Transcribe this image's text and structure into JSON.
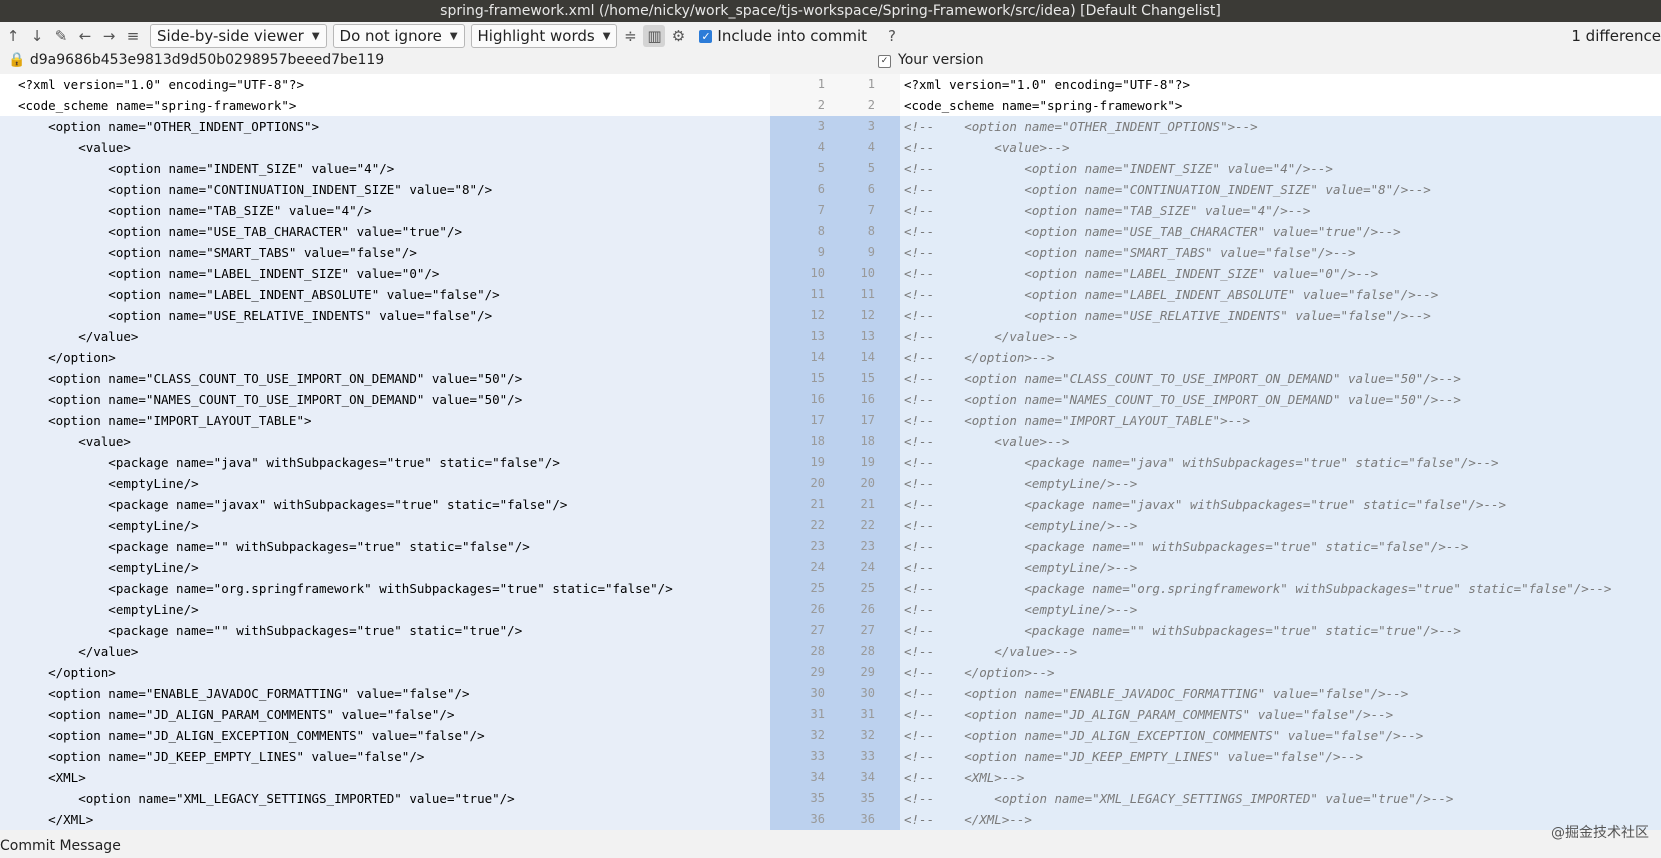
{
  "title": "spring-framework.xml (/home/nicky/work_space/tjs-workspace/Spring-Framework/src/idea) [Default Changelist]",
  "toolbar": {
    "icons": [
      "up-arrow-icon",
      "down-arrow-icon",
      "edit-icon",
      "back-icon",
      "forward-icon",
      "list-icon"
    ],
    "viewer": "Side-by-side viewer",
    "ignore": "Do not ignore",
    "highlight": "Highlight words",
    "include_label": "Include into commit",
    "help": "?",
    "diff_count": "1 difference"
  },
  "left_header": "d9a9686b453e9813d9d50b0298957beeed7be119",
  "right_header": "Your version",
  "commit_label": "Commit Message",
  "watermark": "@掘金技术社区",
  "left_lines": [
    "<?xml version=\"1.0\" encoding=\"UTF-8\"?>",
    "<code_scheme name=\"spring-framework\">",
    "    <option name=\"OTHER_INDENT_OPTIONS\">",
    "        <value>",
    "            <option name=\"INDENT_SIZE\" value=\"4\"/>",
    "            <option name=\"CONTINUATION_INDENT_SIZE\" value=\"8\"/>",
    "            <option name=\"TAB_SIZE\" value=\"4\"/>",
    "            <option name=\"USE_TAB_CHARACTER\" value=\"true\"/>",
    "            <option name=\"SMART_TABS\" value=\"false\"/>",
    "            <option name=\"LABEL_INDENT_SIZE\" value=\"0\"/>",
    "            <option name=\"LABEL_INDENT_ABSOLUTE\" value=\"false\"/>",
    "            <option name=\"USE_RELATIVE_INDENTS\" value=\"false\"/>",
    "        </value>",
    "    </option>",
    "    <option name=\"CLASS_COUNT_TO_USE_IMPORT_ON_DEMAND\" value=\"50\"/>",
    "    <option name=\"NAMES_COUNT_TO_USE_IMPORT_ON_DEMAND\" value=\"50\"/>",
    "    <option name=\"IMPORT_LAYOUT_TABLE\">",
    "        <value>",
    "            <package name=\"java\" withSubpackages=\"true\" static=\"false\"/>",
    "            <emptyLine/>",
    "            <package name=\"javax\" withSubpackages=\"true\" static=\"false\"/>",
    "            <emptyLine/>",
    "            <package name=\"\" withSubpackages=\"true\" static=\"false\"/>",
    "            <emptyLine/>",
    "            <package name=\"org.springframework\" withSubpackages=\"true\" static=\"false\"/>",
    "            <emptyLine/>",
    "            <package name=\"\" withSubpackages=\"true\" static=\"true\"/>",
    "        </value>",
    "    </option>",
    "    <option name=\"ENABLE_JAVADOC_FORMATTING\" value=\"false\"/>",
    "    <option name=\"JD_ALIGN_PARAM_COMMENTS\" value=\"false\"/>",
    "    <option name=\"JD_ALIGN_EXCEPTION_COMMENTS\" value=\"false\"/>",
    "    <option name=\"JD_KEEP_EMPTY_LINES\" value=\"false\"/>",
    "    <XML>",
    "        <option name=\"XML_LEGACY_SETTINGS_IMPORTED\" value=\"true\"/>",
    "    </XML>"
  ],
  "right_lines": [
    "<?xml version=\"1.0\" encoding=\"UTF-8\"?>",
    "<code_scheme name=\"spring-framework\">",
    "<!--    <option name=\"OTHER_INDENT_OPTIONS\">-->",
    "<!--        <value>-->",
    "<!--            <option name=\"INDENT_SIZE\" value=\"4\"/>-->",
    "<!--            <option name=\"CONTINUATION_INDENT_SIZE\" value=\"8\"/>-->",
    "<!--            <option name=\"TAB_SIZE\" value=\"4\"/>-->",
    "<!--            <option name=\"USE_TAB_CHARACTER\" value=\"true\"/>-->",
    "<!--            <option name=\"SMART_TABS\" value=\"false\"/>-->",
    "<!--            <option name=\"LABEL_INDENT_SIZE\" value=\"0\"/>-->",
    "<!--            <option name=\"LABEL_INDENT_ABSOLUTE\" value=\"false\"/>-->",
    "<!--            <option name=\"USE_RELATIVE_INDENTS\" value=\"false\"/>-->",
    "<!--        </value>-->",
    "<!--    </option>-->",
    "<!--    <option name=\"CLASS_COUNT_TO_USE_IMPORT_ON_DEMAND\" value=\"50\"/>-->",
    "<!--    <option name=\"NAMES_COUNT_TO_USE_IMPORT_ON_DEMAND\" value=\"50\"/>-->",
    "<!--    <option name=\"IMPORT_LAYOUT_TABLE\">-->",
    "<!--        <value>-->",
    "<!--            <package name=\"java\" withSubpackages=\"true\" static=\"false\"/>-->",
    "<!--            <emptyLine/>-->",
    "<!--            <package name=\"javax\" withSubpackages=\"true\" static=\"false\"/>-->",
    "<!--            <emptyLine/>-->",
    "<!--            <package name=\"\" withSubpackages=\"true\" static=\"false\"/>-->",
    "<!--            <emptyLine/>-->",
    "<!--            <package name=\"org.springframework\" withSubpackages=\"true\" static=\"false\"/>-->",
    "<!--            <emptyLine/>-->",
    "<!--            <package name=\"\" withSubpackages=\"true\" static=\"true\"/>-->",
    "<!--        </value>-->",
    "<!--    </option>-->",
    "<!--    <option name=\"ENABLE_JAVADOC_FORMATTING\" value=\"false\"/>-->",
    "<!--    <option name=\"JD_ALIGN_PARAM_COMMENTS\" value=\"false\"/>-->",
    "<!--    <option name=\"JD_ALIGN_EXCEPTION_COMMENTS\" value=\"false\"/>-->",
    "<!--    <option name=\"JD_KEEP_EMPTY_LINES\" value=\"false\"/>-->",
    "<!--    <XML>-->",
    "<!--        <option name=\"XML_LEGACY_SETTINGS_IMPORTED\" value=\"true\"/>-->",
    "<!--    </XML>-->"
  ],
  "line_numbers": [
    "1",
    "2",
    "3",
    "4",
    "5",
    "6",
    "7",
    "8",
    "9",
    "10",
    "11",
    "12",
    "13",
    "14",
    "15",
    "16",
    "17",
    "18",
    "19",
    "20",
    "21",
    "22",
    "23",
    "24",
    "25",
    "26",
    "27",
    "28",
    "29",
    "30",
    "31",
    "32",
    "33",
    "34",
    "35",
    "36"
  ],
  "changed_from": 3
}
